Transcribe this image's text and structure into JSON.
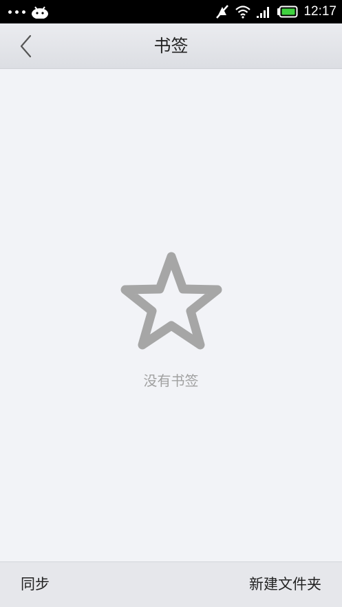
{
  "status_bar": {
    "time": "12:17",
    "icons": [
      "notification-dots-icon",
      "android-icon",
      "mute-icon",
      "wifi-icon",
      "signal-icon",
      "battery-icon"
    ],
    "battery_color": "#3fd23f"
  },
  "header": {
    "title": "书签",
    "back_icon": "chevron-left-icon"
  },
  "empty_state": {
    "icon": "star-outline-icon",
    "message": "没有书签"
  },
  "bottom_bar": {
    "sync_label": "同步",
    "new_folder_label": "新建文件夹"
  },
  "colors": {
    "background": "#f2f3f7",
    "star": "#a6a6a6",
    "empty_text": "#a0a0a0"
  }
}
